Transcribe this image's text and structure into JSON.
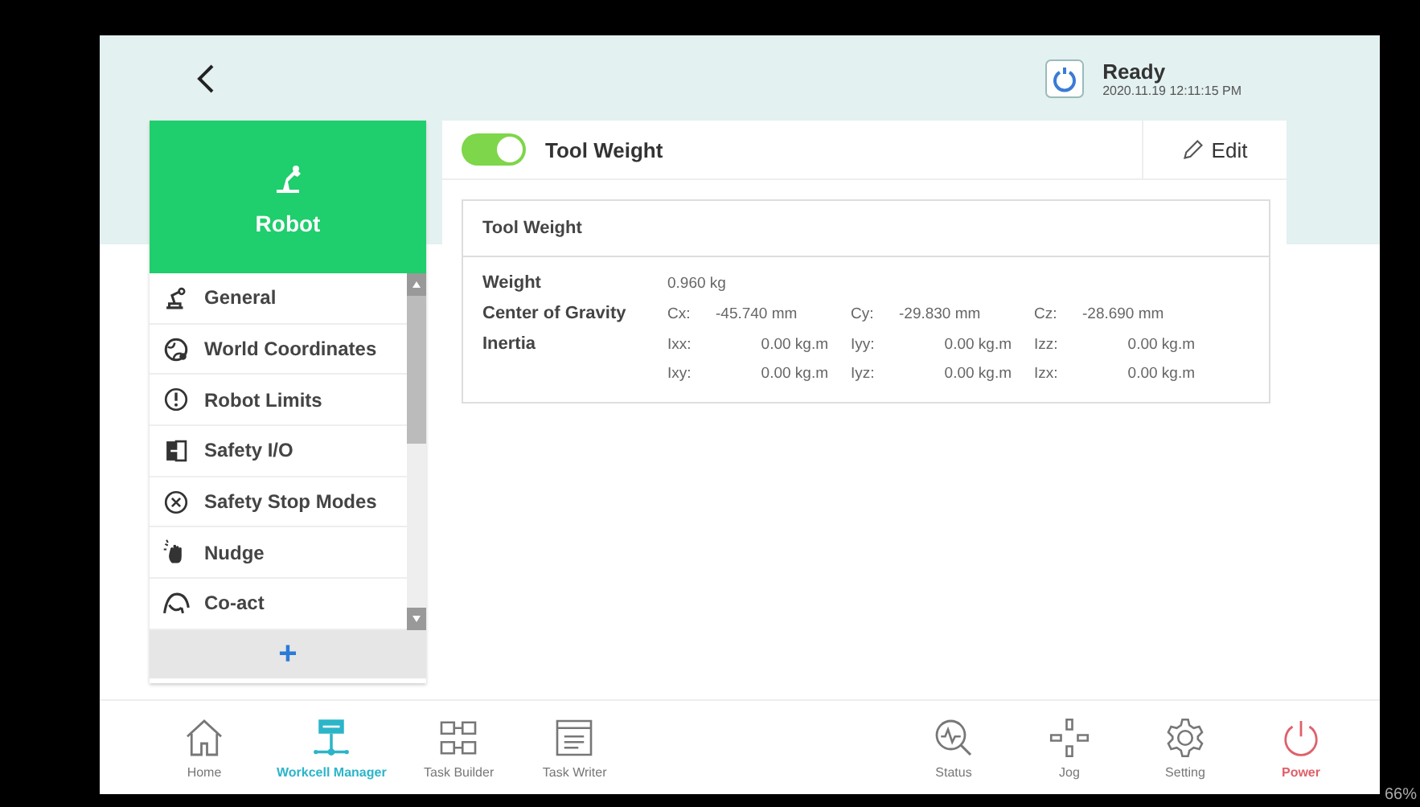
{
  "header": {
    "status": {
      "title": "Ready",
      "timestamp": "2020.11.19 12:11:15 PM"
    }
  },
  "sidebar": {
    "title": "Robot",
    "items": [
      {
        "kind": "general",
        "label": "General"
      },
      {
        "kind": "world",
        "label": "World Coordinates"
      },
      {
        "kind": "limits",
        "label": "Robot Limits"
      },
      {
        "kind": "io",
        "label": "Safety I/O"
      },
      {
        "kind": "stop",
        "label": "Safety Stop Modes"
      },
      {
        "kind": "nudge",
        "label": "Nudge"
      },
      {
        "kind": "coact",
        "label": "Co-act"
      }
    ],
    "add_button": "+"
  },
  "panel": {
    "toggle": {
      "on": true
    },
    "title": "Tool Weight",
    "edit_button": "Edit",
    "card": {
      "title": "Tool Weight",
      "rows": [
        {
          "label": "Weight",
          "values": [
            {
              "value": "0.960 kg"
            }
          ]
        },
        {
          "label": "Center of Gravity",
          "values": [
            {
              "key": "Cx:",
              "value": "-45.740 mm"
            },
            {
              "key": "Cy:",
              "value": "-29.830 mm"
            },
            {
              "key": "Cz:",
              "value": "-28.690 mm"
            }
          ]
        },
        {
          "label": "Inertia",
          "values": [
            {
              "key": "Ixx:",
              "value": "0.00 kg.m"
            },
            {
              "key": "Iyy:",
              "value": "0.00 kg.m"
            },
            {
              "key": "Izz:",
              "value": "0.00 kg.m"
            }
          ]
        },
        {
          "values": [
            {
              "key": "Ixy:",
              "value": "0.00 kg.m"
            },
            {
              "key": "Iyz:",
              "value": "0.00 kg.m"
            },
            {
              "key": "Izx:",
              "value": "0.00 kg.m"
            }
          ]
        }
      ]
    }
  },
  "nav": {
    "left": [
      {
        "kind": "home",
        "label": "Home",
        "selected": false
      },
      {
        "kind": "workcell",
        "label": "Workcell Manager",
        "selected": true
      },
      {
        "kind": "builder",
        "label": "Task Builder",
        "selected": false
      },
      {
        "kind": "writer",
        "label": "Task Writer",
        "selected": false
      }
    ],
    "right": [
      {
        "kind": "status",
        "label": "Status",
        "selected": false
      },
      {
        "kind": "jog",
        "label": "Jog",
        "selected": false
      },
      {
        "kind": "setting",
        "label": "Setting",
        "selected": false
      },
      {
        "kind": "power",
        "label": "Power",
        "selected": false
      }
    ]
  },
  "zoom_indicator": "66%"
}
